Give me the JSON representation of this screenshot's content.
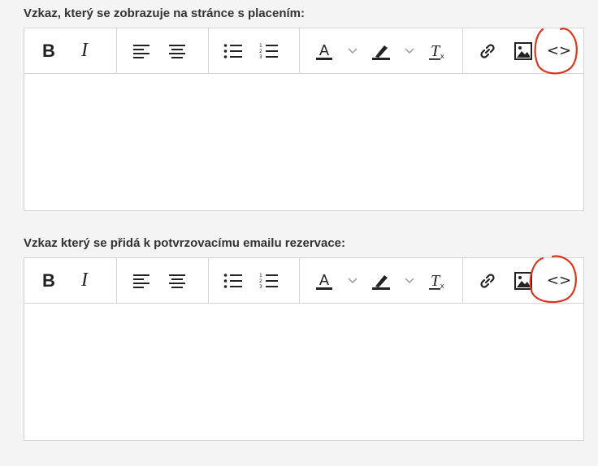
{
  "editors": [
    {
      "label": "Vzkaz, který se zobrazuje na stránce s placením:",
      "content": ""
    },
    {
      "label": "Vzkaz který se přidá k potvrzovacímu emailu rezervace:",
      "content": ""
    }
  ],
  "toolbar": {
    "bold_glyph": "B",
    "italic_glyph": "I",
    "source_glyph": "<>"
  },
  "colors": {
    "annotation": "#d9361e",
    "border": "#d3d3d6",
    "page_bg": "#f4f4f5"
  }
}
